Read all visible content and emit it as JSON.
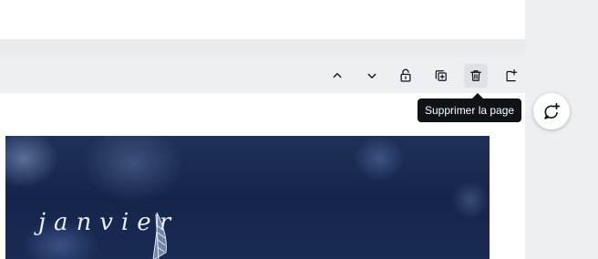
{
  "toolbar": {
    "buttons": [
      {
        "name": "move-page-up",
        "icon": "chevron-up-icon"
      },
      {
        "name": "move-page-down",
        "icon": "chevron-down-icon"
      },
      {
        "name": "lock-page",
        "icon": "lock-open-icon"
      },
      {
        "name": "duplicate-page",
        "icon": "duplicate-icon"
      },
      {
        "name": "delete-page",
        "icon": "trash-icon"
      },
      {
        "name": "add-page",
        "icon": "add-page-icon"
      }
    ]
  },
  "tooltip": {
    "text": "Supprimer la page"
  },
  "design": {
    "text": "janvier"
  },
  "assistant": {
    "icon": "comment-plus-icon"
  },
  "colors": {
    "tooltip_bg": "#0e1318",
    "design_bg": "#1a2b54"
  }
}
